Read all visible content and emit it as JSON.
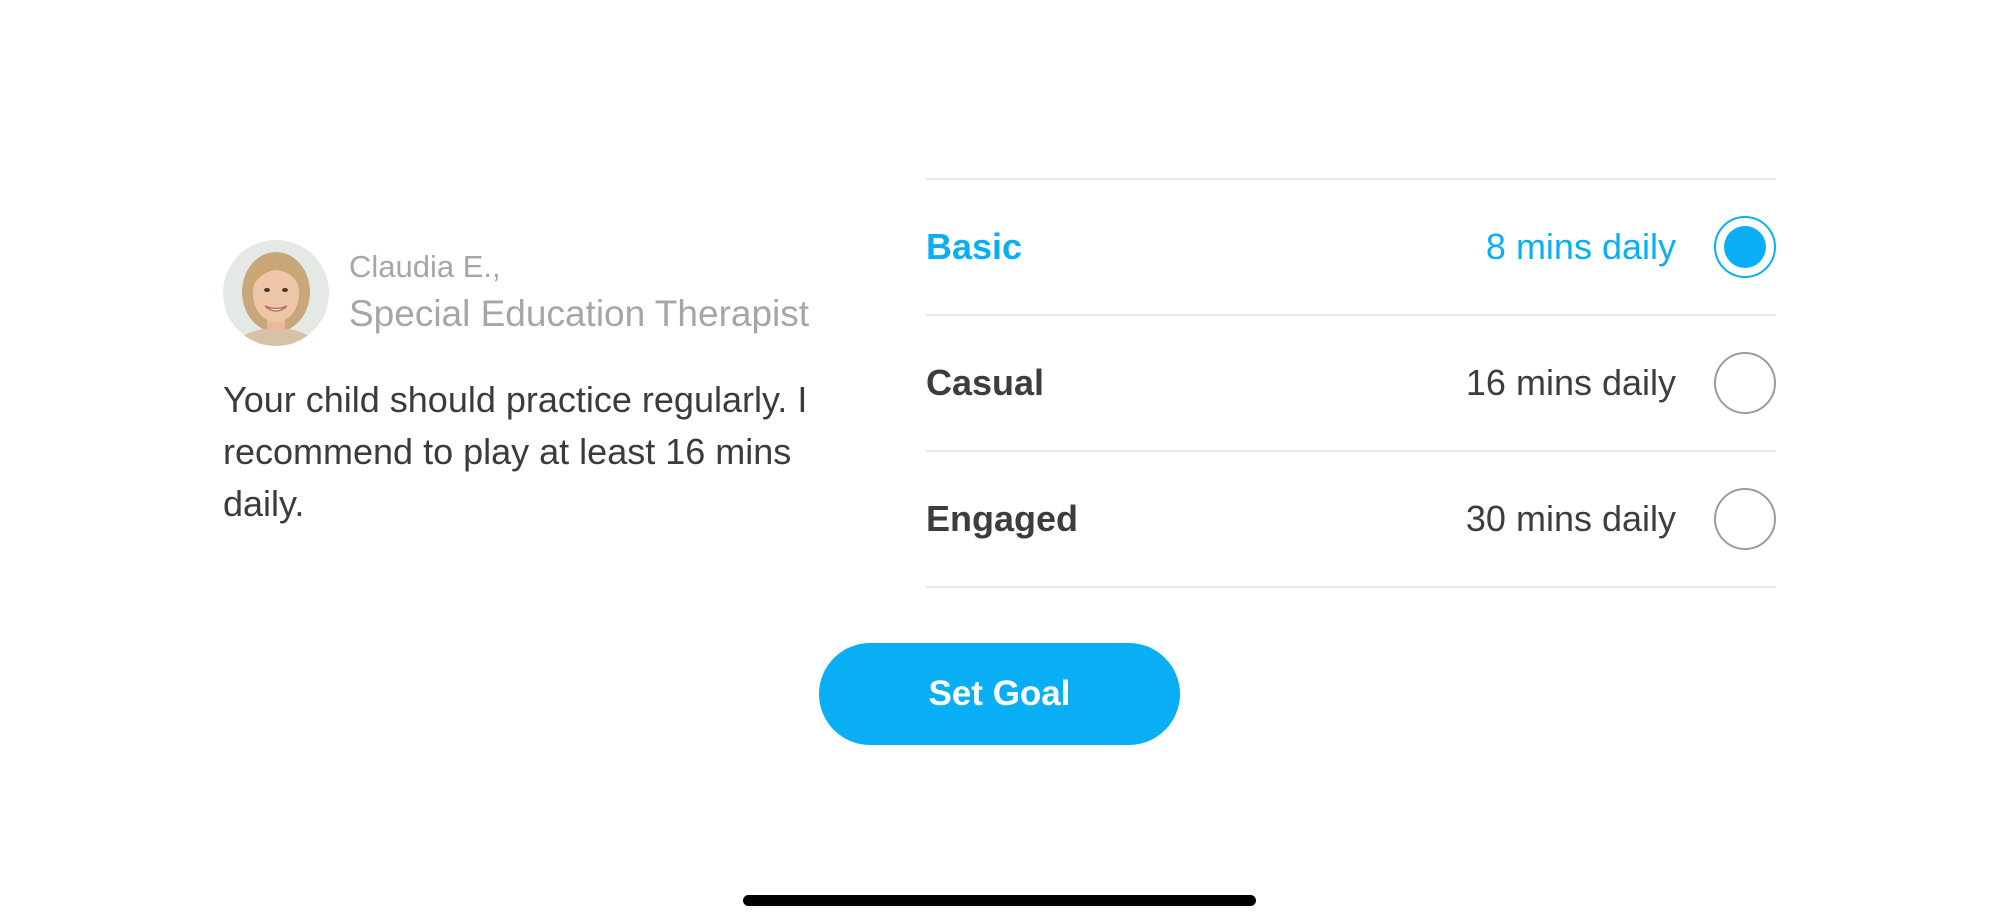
{
  "therapist": {
    "name": "Claudia E.,",
    "role": "Special Education Therapist",
    "avatar_icon": "therapist-portrait",
    "quote": "Your child should practice regularly. I recommend to play at least 16 mins daily."
  },
  "goal_options": [
    {
      "name": "Basic",
      "duration": "8 mins daily",
      "selected": true
    },
    {
      "name": "Casual",
      "duration": "16 mins daily",
      "selected": false
    },
    {
      "name": "Engaged",
      "duration": "30 mins daily",
      "selected": false
    }
  ],
  "actions": {
    "set_goal_label": "Set Goal"
  },
  "colors": {
    "accent": "#0aaef5",
    "text": "#3d3d3d",
    "muted": "#a6a6a6",
    "divider": "#e6e6e6"
  }
}
